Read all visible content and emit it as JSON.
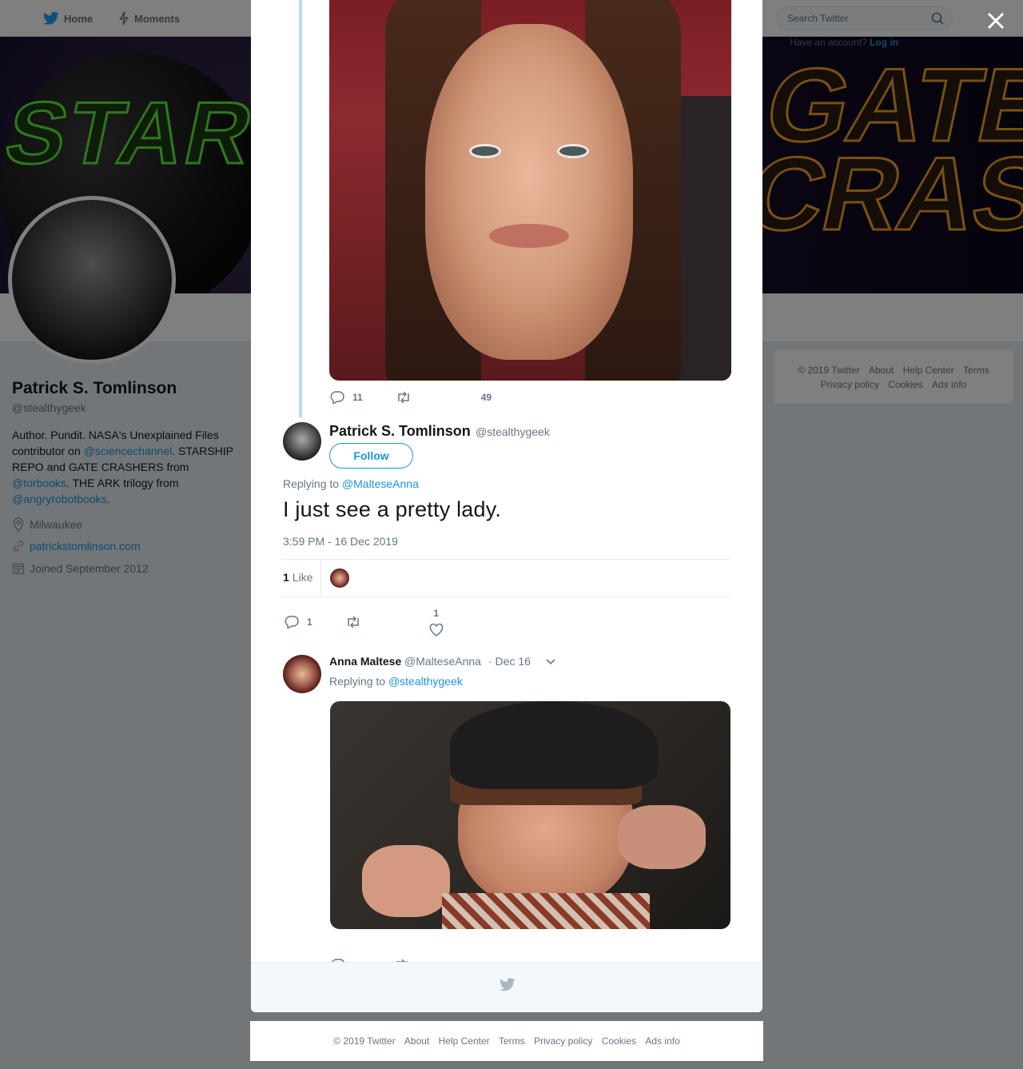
{
  "nav": {
    "home_label": "Home",
    "moments_label": "Moments",
    "search_placeholder": "Search Twitter",
    "login_hint_prefix": "Have an account?",
    "login_label": "Log in"
  },
  "banner": {
    "left_text": "STARSHIP REPO",
    "right_text": "GATE CRASHERS"
  },
  "profile": {
    "name": "Patrick S. Tomlinson",
    "handle": "@stealthygeek",
    "bio_parts": {
      "p1": "Author. Pundit. NASA's Unexplained Files contributor on ",
      "l1": "@sciencechannel",
      "p2": ". STARSHIP REPO and GATE CRASHERS from ",
      "l2": "@torbooks",
      "p3": ". THE ARK trilogy from ",
      "l3": "@angryrobotbooks",
      "p4": "."
    },
    "location": "Milwaukee",
    "website": "patrickstomlinson.com",
    "joined": "Joined September 2012"
  },
  "side_footer": {
    "copyright": "© 2019 Twitter",
    "about": "About",
    "help": "Help Center",
    "terms": "Terms",
    "privacy": "Privacy policy",
    "cookies": "Cookies",
    "ads": "Ads info"
  },
  "parent_tweet": {
    "reply_count": "11",
    "like_count": "49"
  },
  "main_tweet": {
    "author_name": "Patrick S. Tomlinson",
    "author_handle": "@stealthygeek",
    "follow_label": "Follow",
    "replying_prefix": "Replying to",
    "replying_to": "@MalteseAnna",
    "text": "I just see a pretty lady.",
    "timestamp": "3:59 PM - 16 Dec 2019",
    "likes_count": "1",
    "likes_label": "Like",
    "reply_count": "1",
    "like_count": "1"
  },
  "reply_tweet": {
    "author_name": "Anna Maltese",
    "author_handle": "@MalteseAnna",
    "date": "· Dec 16",
    "replying_prefix": "Replying to",
    "replying_to": "@stealthygeek"
  },
  "page_footer": {
    "copyright": "© 2019 Twitter",
    "about": "About",
    "help": "Help Center",
    "terms": "Terms",
    "privacy": "Privacy policy",
    "cookies": "Cookies",
    "ads": "Ads info"
  },
  "icons": {
    "twitter_bird": "twitter-bird-icon",
    "moments": "lightning-icon",
    "search": "search-icon",
    "close": "close-icon",
    "reply": "reply-icon",
    "retweet": "retweet-icon",
    "like": "heart-icon",
    "location": "location-pin-icon",
    "link": "link-icon",
    "calendar": "calendar-icon",
    "caret": "chevron-down-icon"
  },
  "colors": {
    "accent": "#1b95e0",
    "text_secondary": "#657786",
    "thread_line": "#b8dbe8"
  }
}
